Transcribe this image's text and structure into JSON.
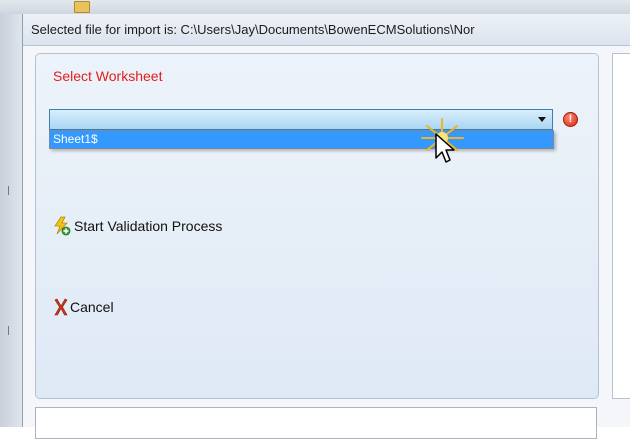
{
  "window": {
    "title": "Selected file for import is: C:\\Users\\Jay\\Documents\\BowenECMSolutions\\Nor"
  },
  "form": {
    "worksheet_label": "Select Worksheet",
    "worksheet_select": {
      "value": "",
      "options": [
        "Sheet1$"
      ],
      "highlighted_option": "Sheet1$",
      "expanded": true
    },
    "warning_icon": "error-icon",
    "validate_label": "Start Validation Process",
    "validate_icon": "lightning-add-icon",
    "cancel_label": "Cancel",
    "cancel_icon": "cancel-x-icon"
  },
  "colors": {
    "label_red": "#e21d1d",
    "highlight_blue": "#3399ff",
    "combo_gradient_top": "#d9eefc",
    "combo_gradient_bottom": "#a9d5f2"
  }
}
